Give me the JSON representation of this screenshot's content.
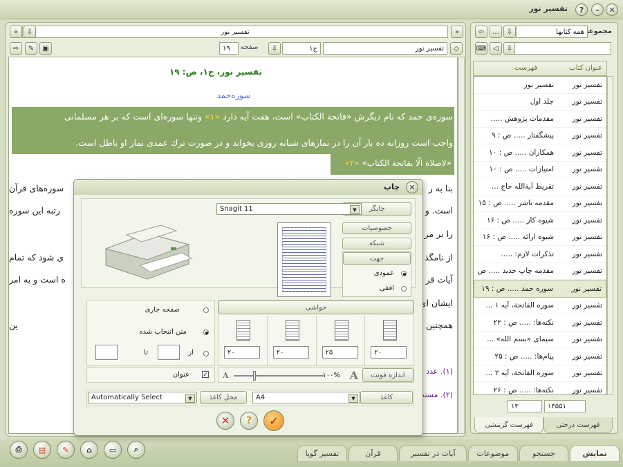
{
  "window": {
    "title": "تفسير نور"
  },
  "doc_toolbar": {
    "breadcrumb": "تفسير نور",
    "book": "تفسير نور",
    "volume": "ج۱",
    "page_label": "صفحه",
    "page_value": "۱۹"
  },
  "doc": {
    "heading": "تفسير نور، ج۱، ص: ۱۹",
    "surah": "سوره‌حمد",
    "hl_line1_a": "سوره‌ى حمد كه نام ديگرش «فاتحة الكتاب» است، هفت آيه دارد",
    "hl_line1_num": "«۱»",
    "hl_line1_b": "وتنها سوره‌اى است كه بر هر مسلمانى",
    "hl_line2": "واجب است روزانه ده بار آن را در نمازهاى شبانه روزى بخواند و در صورت ترك عمدى نماز او باطل است.",
    "hl_line3": "«لاصلاة الّا بفاتحة الكتاب»",
    "hl_line3_num": "«۲»",
    "p1_left": "سوره‌هاى قرآن",
    "p1_right": "بنا به ر",
    "p2_left": "رتبه اين سوره",
    "p2_right": "است. و ب",
    "p3_right": "را بر مر",
    "p4_left": "ى شود كه تمام",
    "p4_right": "از نامگذ",
    "p5_left": "ه است و به امر",
    "p5_right": "آيات قر",
    "p6_right": "ايشان اي",
    "p7_left": "ين",
    "p7_right": "همچنين",
    "fn1": "(۱). عدد",
    "fn2": "(۲). مستد"
  },
  "right_panel": {
    "collection_label": "مجموعه كتب",
    "collection_value": "همه كتابها",
    "col_title": "عنوان كتاب",
    "col_index": "فهرست",
    "rows": [
      {
        "book": "تفسير نور",
        "entry": "تفسير نور"
      },
      {
        "book": "تفسير نور",
        "entry": "جلد اول"
      },
      {
        "book": "تفسير نور",
        "entry": "مقدمات پژوهش ....."
      },
      {
        "book": "تفسير نور",
        "entry": "پيشگفتار ..... ص : ۹"
      },
      {
        "book": "تفسير نور",
        "entry": "همكاران ..... ص : ۱۰"
      },
      {
        "book": "تفسير نور",
        "entry": "امتيازات ..... ص : ۱۰"
      },
      {
        "book": "تفسير نور",
        "entry": "تقريظ آية‌الله حاج ..."
      },
      {
        "book": "تفسير نور",
        "entry": "مقدمه ناشر ..... ص : ۱۵"
      },
      {
        "book": "تفسير نور",
        "entry": "شيوه كار ..... ص : ۱۶"
      },
      {
        "book": "تفسير نور",
        "entry": "شيوه ارائه ..... ص : ۱۶"
      },
      {
        "book": "تفسير نور",
        "entry": "تذكرات لازم: ....."
      },
      {
        "book": "تفسير نور",
        "entry": "مقدمه چاپ جديد ..... ص"
      },
      {
        "book": "تفسير نور",
        "entry": "سوره حمد ..... ص : ۱۹"
      },
      {
        "book": "تفسير نور",
        "entry": "سوره الفاتحة، آيه ۱ ..."
      },
      {
        "book": "تفسير نور",
        "entry": "نكته‌ها: ..... ص : ۲۲"
      },
      {
        "book": "تفسير نور",
        "entry": "سيماى «بسم اللّه» ..."
      },
      {
        "book": "تفسير نور",
        "entry": "پيام‌ها: ..... ص : ۲۵"
      },
      {
        "book": "تفسير نور",
        "entry": "سوره الفاتحة، آيه ۲ ..."
      },
      {
        "book": "تفسير نور",
        "entry": "نكته‌ها: ..... ص : ۲۶"
      },
      {
        "book": "تفسير نور",
        "entry": "پيام‌ها: ..... ص : ۲۷"
      }
    ],
    "status_total": "۱۳۵۵۱",
    "status_current": "۱۳",
    "tab_tree": "فهرست درختى",
    "tab_flat": "فهرست گزينشى"
  },
  "bottom_tabs": [
    "نمايش",
    "جستجو",
    "موضوعات",
    "آيات در تفسير",
    "قرآن",
    "تفسير گويا"
  ],
  "dialog": {
    "title": "چاپ",
    "printer_label": "چاپگر",
    "printer_value": "Snagit 11",
    "properties": "خصوصيات",
    "network": "شبكه",
    "orientation_label": "جهت",
    "portrait": "عمودى",
    "landscape": "افقى",
    "margins_label": "حواشى",
    "margins": [
      "۲۰",
      "۲۰",
      "۲۵",
      "۲۰"
    ],
    "current_page": "صفحه جارى",
    "selected_text": "متن انتخاب شده",
    "from": "از",
    "to": "تا",
    "title_check": "عنوان",
    "font_size_label": "اندازه فونت",
    "font_percent": "۱۰۰%",
    "font_big_a": "A",
    "font_small_a": "A",
    "paper_label": "كاغذ",
    "paper_value": "A4",
    "paper_source_label": "محل كاغذ",
    "paper_source_value": "Automatically Select"
  },
  "colors": {
    "accent_green": "#8aa867",
    "heading_green": "#2f7a1f",
    "surah_blue": "#5a6fd6",
    "cancel_red": "#d0281f",
    "ok_orange": "#e98b1f"
  }
}
